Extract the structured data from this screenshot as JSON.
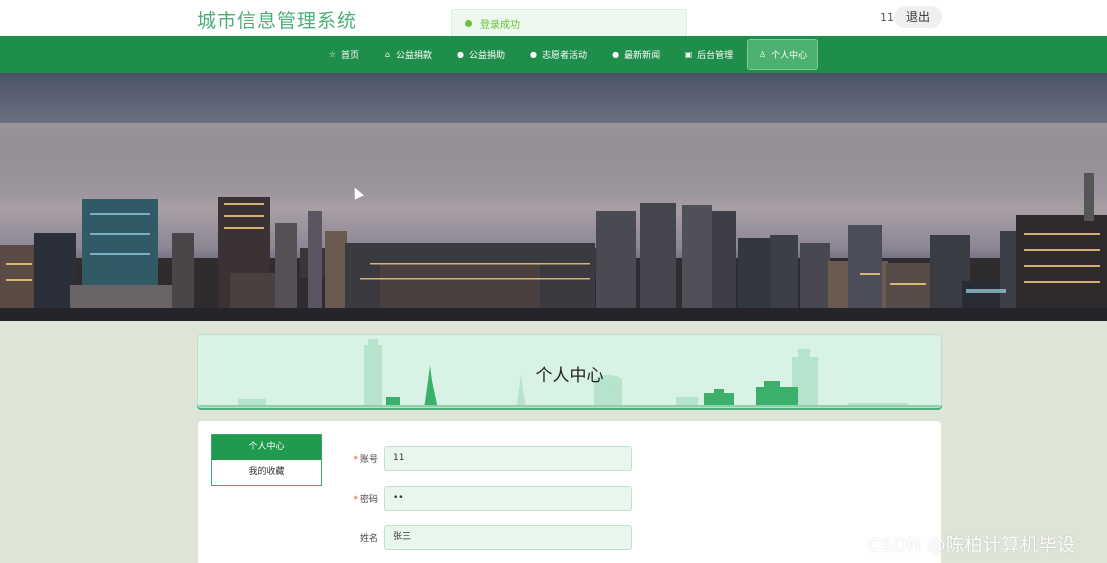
{
  "header": {
    "site_title": "城市信息管理系统",
    "toast": "登录成功",
    "user_id": "11",
    "logout_label": "退出"
  },
  "nav": {
    "items": [
      {
        "label": "首页",
        "icon": "star-icon"
      },
      {
        "label": "公益捐款",
        "icon": "bag-icon"
      },
      {
        "label": "公益捐助",
        "icon": "info-circle-icon"
      },
      {
        "label": "志愿者活动",
        "icon": "info-circle-icon"
      },
      {
        "label": "最新新闻",
        "icon": "info-circle-icon"
      },
      {
        "label": "后台管理",
        "icon": "box-icon"
      },
      {
        "label": "个人中心",
        "icon": "user-icon"
      }
    ],
    "active_index": 6
  },
  "banner": {
    "slide_count": 3,
    "active_slide": 1
  },
  "page": {
    "title": "个人中心"
  },
  "sidebar": {
    "items": [
      {
        "label": "个人中心"
      },
      {
        "label": "我的收藏"
      }
    ]
  },
  "form": {
    "fields": [
      {
        "label": "账号",
        "required": true,
        "value": "11"
      },
      {
        "label": "密码",
        "required": true,
        "value": "••"
      },
      {
        "label": "姓名",
        "required": false,
        "value": "张三"
      }
    ]
  },
  "watermark": "CSDN @陈柏计算机毕设",
  "colors": {
    "nav_green": "#1f8e4a",
    "title_green": "#4caf7a",
    "toast_green": "#67c23a",
    "required_red": "#e0463a"
  }
}
